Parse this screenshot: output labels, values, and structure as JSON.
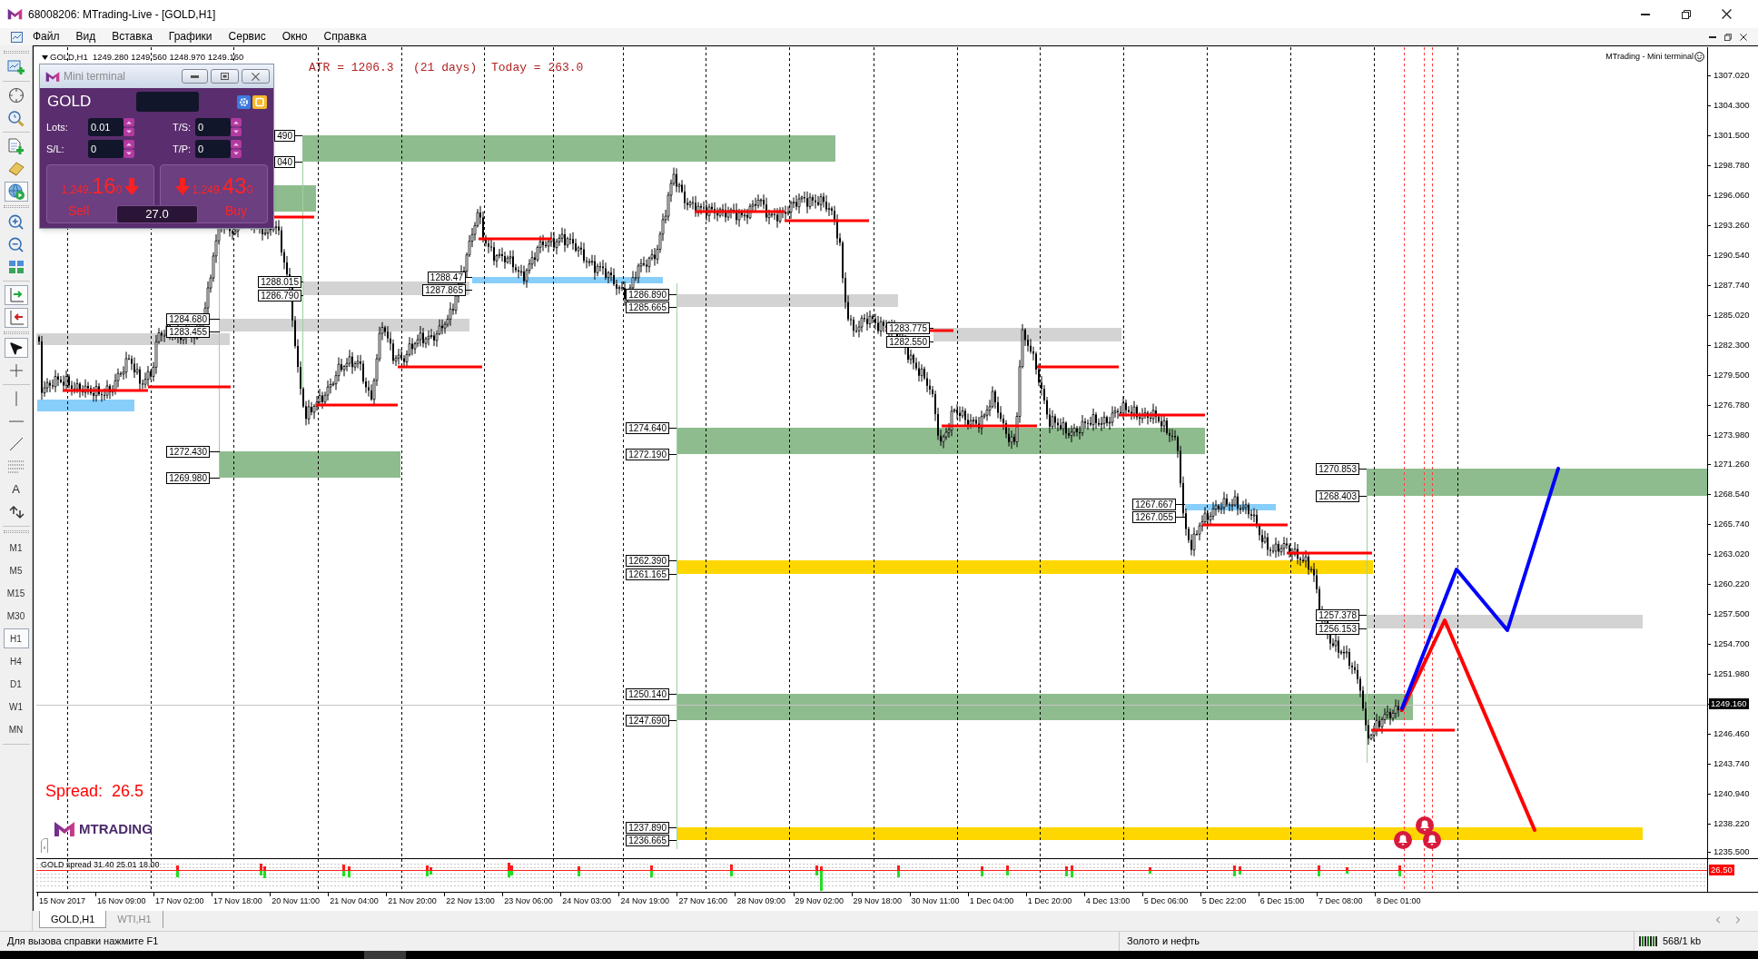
{
  "window": {
    "title": "68008206: MTrading-Live - [GOLD,H1]"
  },
  "menu": [
    {
      "label": "Файл"
    },
    {
      "label": "Вид"
    },
    {
      "label": "Вставка"
    },
    {
      "label": "Графики"
    },
    {
      "label": "Сервис"
    },
    {
      "label": "Окно"
    },
    {
      "label": "Справка"
    }
  ],
  "toolbar": {
    "groups": [
      {
        "tools": [
          {
            "kind": "new-chart",
            "selected": false
          }
        ]
      },
      {
        "tools": [
          {
            "kind": "crosshair",
            "selected": false
          },
          {
            "kind": "data-window",
            "selected": false
          }
        ]
      },
      {
        "tools": [
          {
            "kind": "new-order",
            "selected": false
          },
          {
            "kind": "eraser",
            "selected": false
          },
          {
            "kind": "tester",
            "selected": true
          }
        ]
      },
      {
        "tools": [
          {
            "kind": "zoom-in",
            "selected": false
          },
          {
            "kind": "zoom-out",
            "selected": false
          },
          {
            "kind": "tile",
            "selected": false
          }
        ]
      },
      {
        "tools": [
          {
            "kind": "chart-shift",
            "selected": true
          },
          {
            "kind": "autoscroll",
            "selected": true
          }
        ]
      },
      {
        "tools": [
          {
            "kind": "cursor",
            "selected": true
          },
          {
            "kind": "crosshair-tool",
            "selected": false
          }
        ]
      },
      {
        "tools": [
          {
            "kind": "vertical-line",
            "selected": false
          },
          {
            "kind": "horizontal-line",
            "selected": false
          },
          {
            "kind": "trend-line",
            "selected": false
          },
          {
            "kind": "fibonacci",
            "selected": false
          },
          {
            "kind": "text",
            "label": "A",
            "selected": false
          },
          {
            "kind": "arrows",
            "selected": false
          }
        ]
      }
    ],
    "timeframes": [
      {
        "label": "M1",
        "selected": false
      },
      {
        "label": "M5",
        "selected": false
      },
      {
        "label": "M15",
        "selected": false
      },
      {
        "label": "M30",
        "selected": false
      },
      {
        "label": "H1",
        "selected": true
      },
      {
        "label": "H4",
        "selected": false
      },
      {
        "label": "D1",
        "selected": false
      },
      {
        "label": "W1",
        "selected": false
      },
      {
        "label": "MN",
        "selected": false
      }
    ]
  },
  "chart": {
    "header": "GOLD,H1  1249.280 1249.560 1248.970 1249.160",
    "atr": [
      "ATR = 1206.3",
      "(21 days)",
      "Today = 263.0"
    ],
    "caption": "MTrading - Mini terminal",
    "zones": [
      {
        "color": "#8fbc8f",
        "labels": [
          "490",
          "040"
        ]
      },
      {
        "color": "#8fbc8f"
      },
      {
        "color": "#87cefa",
        "labels": [
          "1288.47",
          "1287.865"
        ]
      },
      {
        "color": "#d3d3d3",
        "labels": [
          "1288.015",
          "1286.790"
        ]
      },
      {
        "color": "#d3d3d3",
        "labels": [
          "1286.890",
          "1285.665"
        ]
      },
      {
        "color": "#d3d3d3",
        "labels": [
          "1284.680",
          "1283.455"
        ]
      },
      {
        "color": "#d3d3d3",
        "labels": [
          "1283.775",
          "1282.550"
        ]
      },
      {
        "color": "#d3d3d3"
      },
      {
        "color": "#87cefa"
      },
      {
        "color": "#8fbc8f",
        "labels": [
          "1274.640",
          "1272.190"
        ]
      },
      {
        "color": "#8fbc8f",
        "labels": [
          "1272.430",
          "1269.980"
        ]
      },
      {
        "color": "#8fbc8f",
        "labels": [
          "1270.853",
          "1268.403"
        ]
      },
      {
        "color": "#87cefa",
        "labels": [
          "1267.667",
          "1267.055"
        ]
      },
      {
        "color": "#ffd700",
        "labels": [
          "1262.390",
          "1261.165"
        ]
      },
      {
        "color": "#d3d3d3",
        "labels": [
          "1257.378",
          "1256.153"
        ]
      },
      {
        "color": "#8fbc8f",
        "labels": [
          "1250.140",
          "1247.690"
        ]
      },
      {
        "color": "#ffd700",
        "labels": [
          "1237.890",
          "1236.665"
        ]
      }
    ],
    "spread_text": "Spread:  26.5",
    "logo_text": "MTRADING",
    "price_axis": [
      {
        "label": "1307.020",
        "kind": "tick"
      },
      {
        "label": "1304.300",
        "kind": "tick"
      },
      {
        "label": "1301.500",
        "kind": "tick"
      },
      {
        "label": "1298.780",
        "kind": "tick"
      },
      {
        "label": "1296.060",
        "kind": "tick"
      },
      {
        "label": "1293.260",
        "kind": "tick"
      },
      {
        "label": "1290.540",
        "kind": "tick"
      },
      {
        "label": "1287.740",
        "kind": "tick"
      },
      {
        "label": "1285.020",
        "kind": "tick"
      },
      {
        "label": "1282.300",
        "kind": "tick"
      },
      {
        "label": "1279.500",
        "kind": "tick"
      },
      {
        "label": "1276.780",
        "kind": "tick"
      },
      {
        "label": "1273.980",
        "kind": "tick"
      },
      {
        "label": "1271.260",
        "kind": "tick"
      },
      {
        "label": "1268.540",
        "kind": "tick"
      },
      {
        "label": "1265.740",
        "kind": "tick"
      },
      {
        "label": "1263.020",
        "kind": "tick"
      },
      {
        "label": "1260.220",
        "kind": "tick"
      },
      {
        "label": "1257.500",
        "kind": "tick"
      },
      {
        "label": "1254.700",
        "kind": "tick"
      },
      {
        "label": "1251.980",
        "kind": "tick"
      },
      {
        "label": "1249.160",
        "kind": "current"
      },
      {
        "label": "1246.460",
        "kind": "tick"
      },
      {
        "label": "1243.740",
        "kind": "tick"
      },
      {
        "label": "1240.940",
        "kind": "tick"
      },
      {
        "label": "1238.220",
        "kind": "tick"
      },
      {
        "label": "1235.500",
        "kind": "tick"
      }
    ],
    "indicator": {
      "title": "GOLD spread 31.40 25.01 18.00",
      "value": "26.50"
    },
    "time_axis": [
      "15 Nov 2017",
      "16 Nov 09:00",
      "17 Nov 02:00",
      "17 Nov 18:00",
      "20 Nov 11:00",
      "21 Nov 04:00",
      "21 Nov 20:00",
      "22 Nov 13:00",
      "23 Nov 06:00",
      "24 Nov 03:00",
      "24 Nov 19:00",
      "27 Nov 16:00",
      "28 Nov 09:00",
      "29 Nov 02:00",
      "29 Nov 18:00",
      "30 Nov 11:00",
      "1 Dec 04:00",
      "1 Dec 20:00",
      "4 Dec 13:00",
      "5 Dec 06:00",
      "5 Dec 22:00",
      "6 Dec 15:00",
      "7 Dec 08:00",
      "8 Dec 01:00"
    ]
  },
  "mini_terminal": {
    "title": "Mini terminal",
    "symbol": "GOLD",
    "fields": [
      {
        "label": "Lots:",
        "value": "0.01"
      },
      {
        "label": "T/S:",
        "value": "0"
      },
      {
        "label": "S/L:",
        "value": "0"
      },
      {
        "label": "T/P:",
        "value": "0"
      }
    ],
    "sell": {
      "label": "Sell",
      "price_head": "1,249.",
      "price_big": "16",
      "price_tail": "0",
      "falling": true
    },
    "buy": {
      "label": "Buy",
      "price_head": "1,249.",
      "price_big": "43",
      "price_tail": "0",
      "falling": true
    },
    "spread": "27.0"
  },
  "tabs": [
    {
      "label": "GOLD,H1",
      "selected": true
    },
    {
      "label": "WTI,H1",
      "selected": false
    }
  ],
  "status_bar": {
    "hint": "Для вызова справки нажмите F1",
    "profile": "Золото и нефть",
    "traffic": "568/1 kb"
  }
}
